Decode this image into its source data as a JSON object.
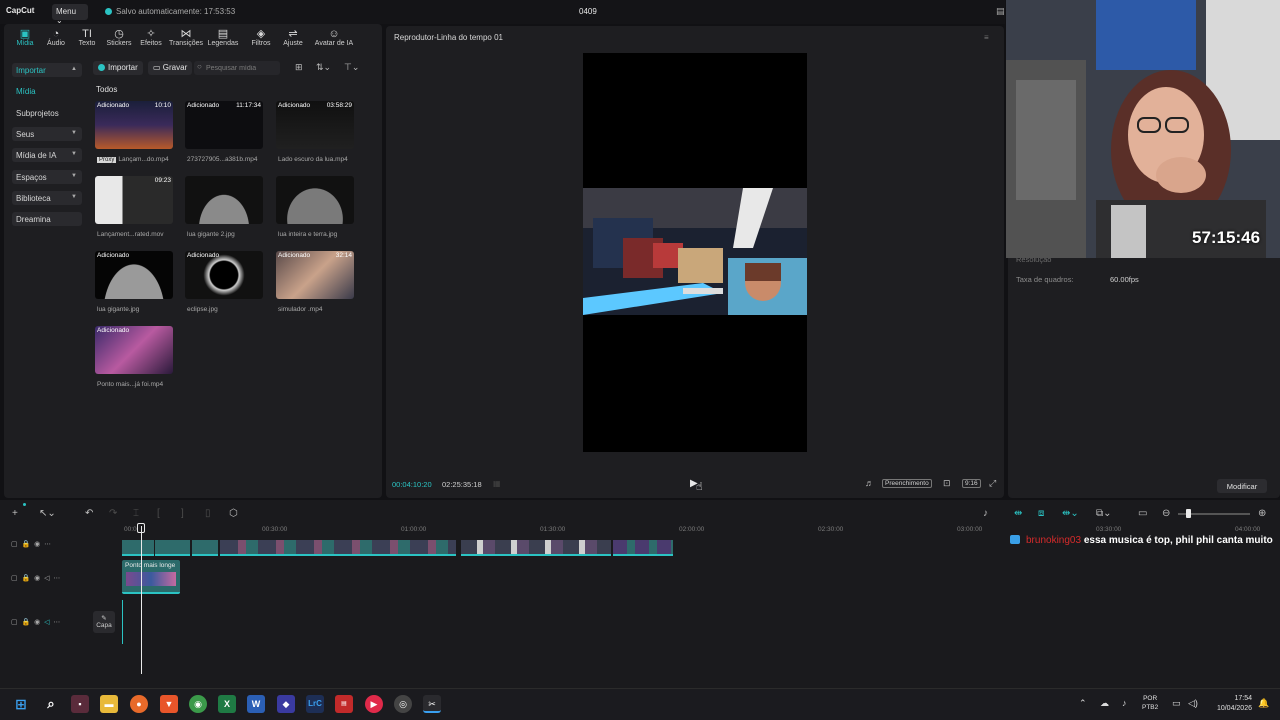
{
  "app": {
    "logo": "CapCut",
    "menu_label": "Menu",
    "autosave_text": "Salvo automaticamente: 17:53:53",
    "project_name": "0409"
  },
  "tool_tabs": [
    {
      "label": "Mídia",
      "icon": "media-icon",
      "glyph": "▣"
    },
    {
      "label": "Áudio",
      "icon": "audio-icon",
      "glyph": "◔"
    },
    {
      "label": "Texto",
      "icon": "text-icon",
      "glyph": "TI"
    },
    {
      "label": "Stickers",
      "icon": "sticker-icon",
      "glyph": "◷"
    },
    {
      "label": "Efeitos",
      "icon": "effects-icon",
      "glyph": "✧"
    },
    {
      "label": "Transições",
      "icon": "transitions-icon",
      "glyph": "⋈"
    },
    {
      "label": "Legendas",
      "icon": "captions-icon",
      "glyph": "▤"
    },
    {
      "label": "Filtros",
      "icon": "filters-icon",
      "glyph": "◈"
    },
    {
      "label": "Ajuste",
      "icon": "adjust-icon",
      "glyph": "⇌"
    },
    {
      "label": "Avatar de IA",
      "icon": "ai-avatar-icon",
      "glyph": "☺"
    }
  ],
  "left_nav": [
    {
      "label": "Importar",
      "group": true,
      "selected": true,
      "chevron": "▲"
    },
    {
      "label": "Mídia",
      "group": false,
      "selected": true
    },
    {
      "label": "Subprojetos",
      "group": false,
      "selected": false
    },
    {
      "label": "Seus",
      "group": true,
      "selected": false,
      "chevron": "▼"
    },
    {
      "label": "Mídia de IA",
      "group": true,
      "selected": false,
      "chevron": "▼"
    },
    {
      "label": "Espaços",
      "group": true,
      "selected": false,
      "chevron": "▼"
    },
    {
      "label": "Biblioteca",
      "group": true,
      "selected": false,
      "chevron": "▼"
    },
    {
      "label": "Dreamina",
      "group": true,
      "selected": false
    }
  ],
  "media_toolbar": {
    "import_label": "Importar",
    "record_label": "Gravar",
    "search_placeholder": "Pesquisar mídia",
    "section_label": "Todos"
  },
  "media_items": [
    {
      "name": "Lançam...do.mp4",
      "tag": "Adicionado",
      "duration": "10:10",
      "proxy": "Proxy"
    },
    {
      "name": "273727905...a381b.mp4",
      "tag": "Adicionado",
      "duration": "11:17:34"
    },
    {
      "name": "Lado escuro da lua.mp4",
      "tag": "Adicionado",
      "duration": "03:58:29"
    },
    {
      "name": "Lançament...rated.mov",
      "tag": "",
      "duration": "09:23"
    },
    {
      "name": "lua gigante 2.jpg",
      "tag": "",
      "duration": ""
    },
    {
      "name": "lua inteira e terra.jpg",
      "tag": "",
      "duration": ""
    },
    {
      "name": "lua gigante.jpg",
      "tag": "Adicionado",
      "duration": ""
    },
    {
      "name": "eclipse.jpg",
      "tag": "Adicionado",
      "duration": ""
    },
    {
      "name": "simulador .mp4",
      "tag": "Adicionado",
      "duration": "32:14"
    },
    {
      "name": "Ponto mais...já foi.mp4",
      "tag": "Adicionado",
      "duration": ""
    }
  ],
  "player": {
    "title": "Reprodutor-Linha do tempo 01",
    "current_time": "00:04:10:20",
    "total_time": "02:25:35:18",
    "fill_label": "Preenchimento",
    "ratio_label": "9:16"
  },
  "properties": {
    "res_label": "Resolução",
    "fps_label": "Taxa de quadros:",
    "fps_value": "60.00fps",
    "modify_label": "Modificar"
  },
  "stream": {
    "timer": "57:15:46"
  },
  "timeline": {
    "ruler": [
      "00:00",
      "00:30:00",
      "01:00:00",
      "01:30:00",
      "02:00:00",
      "02:30:00",
      "03:00:00",
      "03:30:00",
      "04:00:00"
    ],
    "overlay_clip_label": "Ponto mais longe",
    "cover_label": "Capa"
  },
  "chat": {
    "user": "brunoking03",
    "message": "essa musica é top, phil phil canta muito"
  },
  "taskbar": {
    "lang_line1": "POR",
    "lang_line2": "PTB2",
    "time": "17:54",
    "date": "10/04/2026"
  },
  "colors": {
    "accent": "#2bc3c3",
    "panel": "#1e1e21",
    "background": "#111114",
    "chat_user": "#d62b2b"
  }
}
